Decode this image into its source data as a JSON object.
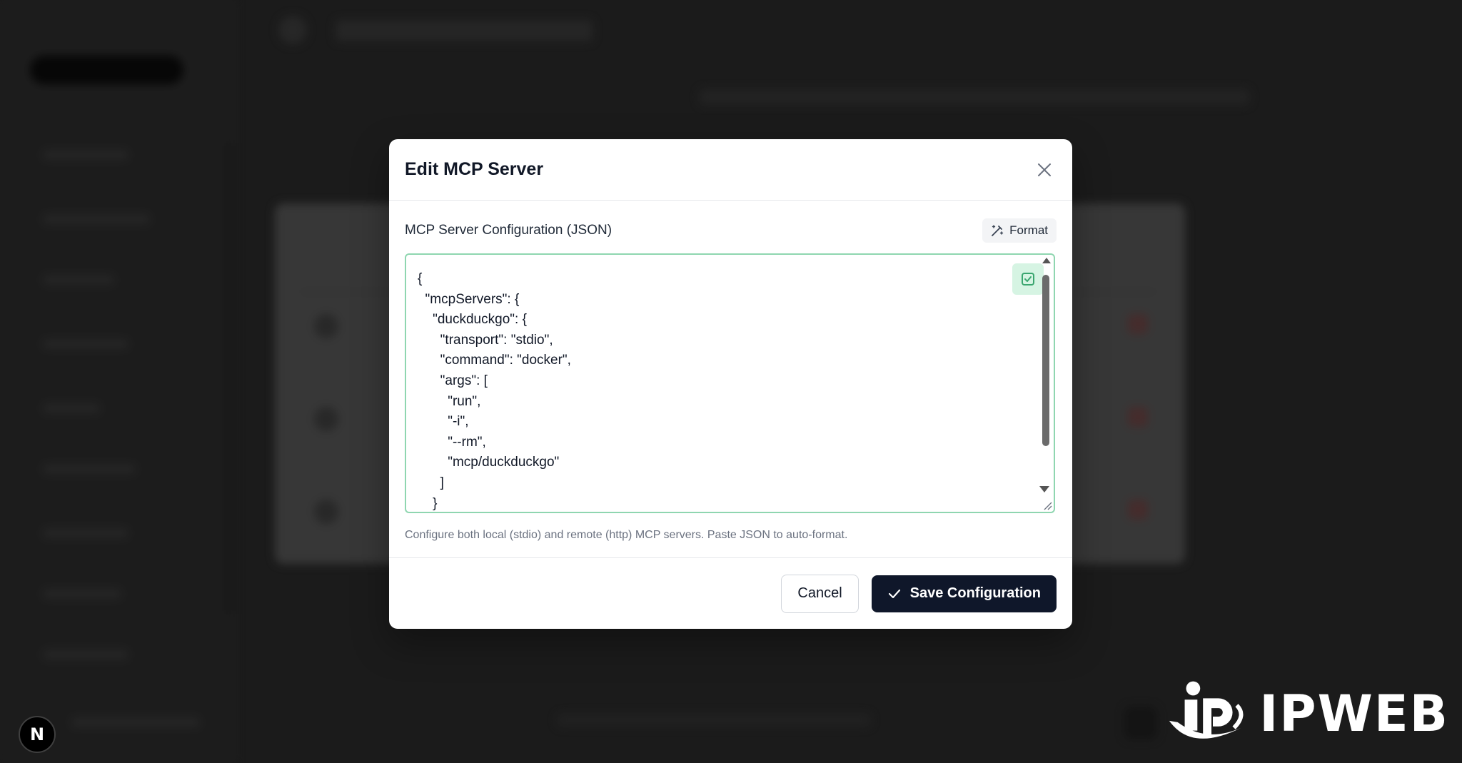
{
  "colors": {
    "accent": "#0f172a",
    "editor_border": "#8fd6b0",
    "valid_bg": "#d6f4e3",
    "valid_icon": "#3aa66f"
  },
  "modal": {
    "title": "Edit MCP Server",
    "close_icon": "x-icon"
  },
  "config": {
    "label": "MCP Server Configuration (JSON)",
    "format_label": "Format",
    "format_icon": "magic-wand-icon",
    "json_value": "{\n  \"mcpServers\": {\n    \"duckduckgo\": {\n      \"transport\": \"stdio\",\n      \"command\": \"docker\",\n      \"args\": [\n        \"run\",\n        \"-i\",\n        \"--rm\",\n        \"mcp/duckduckgo\"\n      ]\n    }",
    "valid_icon": "check-square-icon",
    "helper": "Configure both local (stdio) and remote (http) MCP servers. Paste JSON to auto-format."
  },
  "footer": {
    "cancel_label": "Cancel",
    "save_label": "Save Configuration",
    "save_icon": "check-icon"
  },
  "badge": {
    "letter": "N"
  },
  "watermark": {
    "text": "IPWEB"
  }
}
